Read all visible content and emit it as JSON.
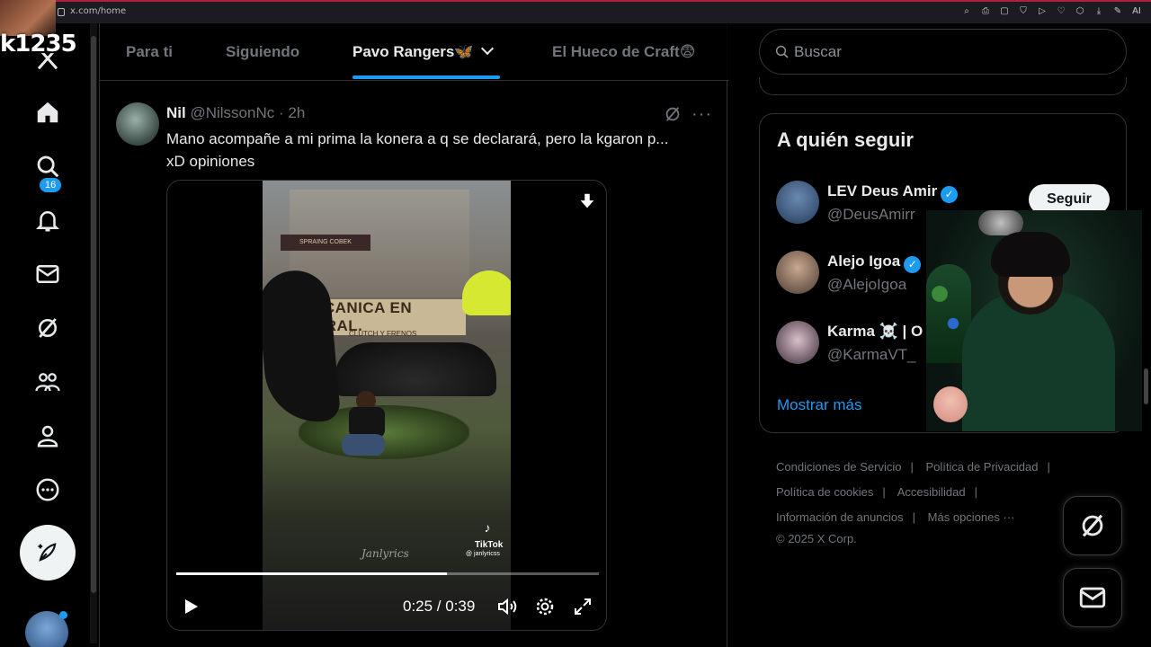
{
  "browser": {
    "url": "x.com/home",
    "extension_icons": [
      "zoom-icon",
      "bookmark-icon",
      "screenshot-icon",
      "shield-icon",
      "play-icon",
      "heart-icon",
      "puzzle-icon",
      "download-icon",
      "pen-icon",
      "ai-icon"
    ],
    "ai_label": "AI"
  },
  "stream_overlay": {
    "name": "k1235"
  },
  "nav": {
    "notification_count": "16",
    "items": [
      "x-logo-icon",
      "home-icon",
      "search-icon",
      "notifications-icon",
      "messages-icon",
      "grok-icon",
      "communities-icon",
      "profile-icon",
      "more-icon"
    ]
  },
  "tabs": [
    {
      "label": "Para ti",
      "active": false
    },
    {
      "label": "Siguiendo",
      "active": false
    },
    {
      "label": "Pavo Rangers🦋",
      "active": true
    },
    {
      "label": "El Hueco de Craft😨",
      "active": false
    }
  ],
  "tweet": {
    "name": "Nil",
    "handle": "@NilssonNc",
    "time": "· 2h",
    "text_line1": "Mano acompañe a mi prima la konera a q se declarará, pero la kgaron p...",
    "text_line2": "xD opiniones",
    "video": {
      "shop_sign": "ECANICA EN GRAL.",
      "shop_sub": "CLUTCH  Y  FRENOS",
      "awning": "SPRAING COBEK",
      "watermark": "Janlyrics",
      "tiktok_label": "TikTok",
      "tiktok_user": "@ janlyricss",
      "current_time": "0:25",
      "duration": "0:39",
      "time_display": "0:25 / 0:39",
      "progress": 0.64
    }
  },
  "sidebar": {
    "search_placeholder": "Buscar",
    "who_to_follow": {
      "title": "A quién seguir",
      "users": [
        {
          "name": "LEV Deus Amir",
          "handle": "@DeusAmirr",
          "verified": true,
          "button": "Seguir"
        },
        {
          "name": "Alejo Igoa",
          "handle": "@AlejoIgoa",
          "verified": true
        },
        {
          "name": "Karma ☠️ | O",
          "handle": "@KarmaVT_",
          "verified": false
        }
      ],
      "show_more": "Mostrar más"
    },
    "footer": {
      "links": [
        "Condiciones de Servicio",
        "Política de Privacidad",
        "Política de cookies",
        "Accesibilidad",
        "Información de anuncios",
        "Más opciones ···"
      ],
      "copyright": "© 2025 X Corp."
    }
  },
  "colors": {
    "accent": "#1d9bf0",
    "background": "#000000",
    "text": "#e7e9ea",
    "muted": "#71767b",
    "border": "#2f3336"
  }
}
